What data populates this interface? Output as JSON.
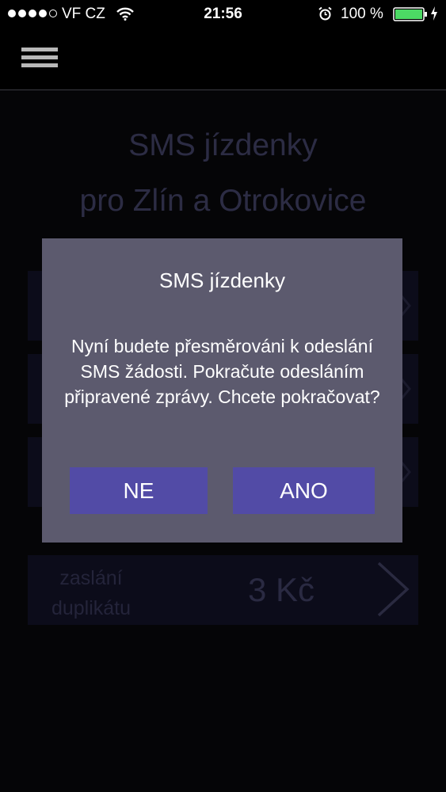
{
  "status_bar": {
    "carrier": "VF CZ",
    "time": "21:56",
    "battery_percent": "100 %",
    "battery_level": 1.0,
    "signal_bars": 4,
    "signal_max": 5,
    "icons": [
      "wifi-icon",
      "alarm-icon",
      "battery-icon",
      "charging-icon"
    ]
  },
  "nav": {
    "menu_icon": "hamburger-icon"
  },
  "main": {
    "title_line1": "SMS jízdenky",
    "title_line2": "pro Zlín a Otrokovice",
    "duplicate_row": {
      "label_line1": "zaslání",
      "label_line2": "duplikátu",
      "price": "3 Kč"
    }
  },
  "dialog": {
    "title": "SMS jízdenky",
    "message": "Nyní budete přesměrováni k odeslání SMS žádosti. Pokračute odesláním připravené zprávy. Chcete pokračovat?",
    "no_label": "NE",
    "yes_label": "ANO"
  },
  "colors": {
    "background": "#050507",
    "dialog_bg": "#5c5a6e",
    "button_bg": "#524ba6",
    "battery_green": "#4cd964"
  }
}
